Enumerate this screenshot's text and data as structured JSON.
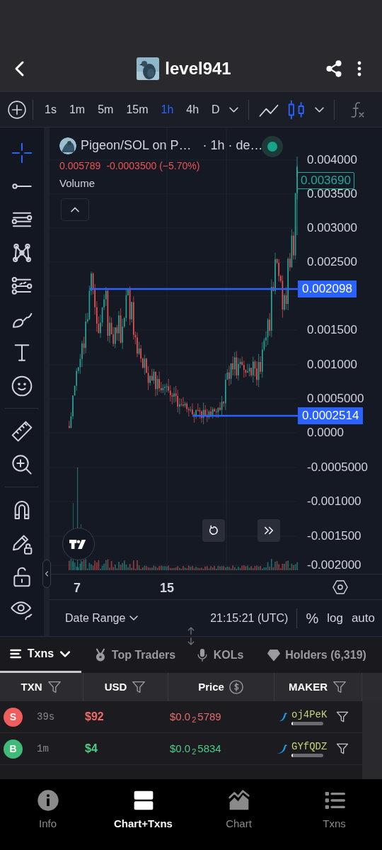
{
  "header": {
    "title": "level941"
  },
  "toolbar": {
    "timeframes": [
      {
        "label": "1s",
        "selected": false
      },
      {
        "label": "1m",
        "selected": false
      },
      {
        "label": "5m",
        "selected": false
      },
      {
        "label": "15m",
        "selected": false
      },
      {
        "label": "1h",
        "selected": true
      },
      {
        "label": "4h",
        "selected": false
      },
      {
        "label": "D",
        "selected": false
      }
    ],
    "chart_types": [
      {
        "kind": "line",
        "selected": false
      },
      {
        "kind": "candles",
        "selected": true
      }
    ]
  },
  "drawing_tools": [
    {
      "kind": "crosshair",
      "selected": true
    },
    {
      "kind": "trend_line",
      "selected": false
    },
    {
      "kind": "parallel",
      "selected": false
    },
    {
      "kind": "pattern",
      "selected": false
    },
    {
      "kind": "fib",
      "selected": false
    },
    {
      "kind": "brush",
      "selected": false
    },
    {
      "kind": "text",
      "selected": false
    },
    {
      "kind": "smiley",
      "selected": false
    },
    {
      "kind": "ruler",
      "selected": false
    },
    {
      "kind": "zoom",
      "selected": false
    },
    {
      "kind": "magnet",
      "selected": false
    },
    {
      "kind": "pencil_lock",
      "selected": false
    },
    {
      "kind": "unlock",
      "selected": false
    },
    {
      "kind": "eye",
      "selected": false
    }
  ],
  "chart": {
    "symbol": "Pigeon/SOL on P…",
    "interval": "· 1h · de…",
    "ohlc": {
      "last": "0.005789",
      "change": "-0.0003500 (−5.70%)"
    },
    "volume_label": "Volume",
    "price_axis": [
      "0.004000",
      "0.003500",
      "0.003000",
      "0.002500",
      "0.001500",
      "0.001000",
      "0.0005000",
      "0.0000",
      "-0.0005000",
      "-0.001000",
      "-0.001500",
      "-0.002000"
    ],
    "current_price": "0.003690",
    "price_lines": [
      "0.002098",
      "0.0002514"
    ],
    "time_axis": [
      "7",
      "15"
    ]
  },
  "bottom_bar": {
    "date_range": "Date Range",
    "time": "21:15:21 (UTC)",
    "options": [
      "%",
      "log",
      "auto"
    ]
  },
  "tabs": [
    {
      "label": "Txns",
      "kind": "txns",
      "selected": true
    },
    {
      "label": "Top Traders",
      "kind": "traders",
      "selected": false
    },
    {
      "label": "KOLs",
      "kind": "kols",
      "selected": false
    },
    {
      "label": "Holders (6,319)",
      "kind": "holders",
      "selected": false
    }
  ],
  "table": {
    "columns": [
      {
        "label": "TXN",
        "kind": "filter"
      },
      {
        "label": "USD",
        "kind": "filter"
      },
      {
        "label": "Price",
        "kind": "currency"
      },
      {
        "label": "MAKER",
        "kind": "filter"
      }
    ],
    "rows": [
      {
        "kind": "sell",
        "badge": "S",
        "age": "39s",
        "usd": "$92",
        "price": {
          "prefix": "$0.0",
          "zeros": "2",
          "digits": "5789"
        },
        "maker": "oj4PeK",
        "level": 0.05
      },
      {
        "kind": "buy",
        "badge": "B",
        "age": "1m",
        "usd": "$4",
        "price": {
          "prefix": "$0.0",
          "zeros": "2",
          "digits": "5834"
        },
        "maker": "GYfQDZ",
        "level": 0.05
      }
    ]
  },
  "bottom_nav": [
    {
      "label": "Info",
      "kind": "info",
      "selected": false
    },
    {
      "label": "Chart+Txns",
      "kind": "split",
      "selected": true
    },
    {
      "label": "Chart",
      "kind": "chart",
      "selected": false
    },
    {
      "label": "Txns",
      "kind": "list",
      "selected": false
    }
  ]
}
